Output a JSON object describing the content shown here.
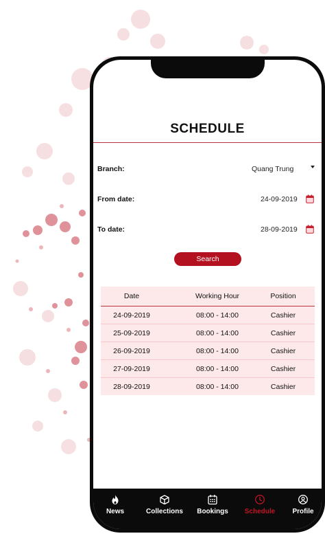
{
  "screen": {
    "title": "SCHEDULE"
  },
  "form": {
    "branch": {
      "label": "Branch:",
      "value": "Quang Trung",
      "icon": "chevron-down-icon"
    },
    "from_date": {
      "label": "From date:",
      "value": "24-09-2019",
      "icon": "calendar-icon"
    },
    "to_date": {
      "label": "To date:",
      "value": "28-09-2019",
      "icon": "calendar-icon"
    },
    "search_label": "Search"
  },
  "table": {
    "headers": [
      "Date",
      "Working Hour",
      "Position"
    ],
    "rows": [
      [
        "24-09-2019",
        "08:00 - 14:00",
        "Cashier"
      ],
      [
        "25-09-2019",
        "08:00 - 14:00",
        "Cashier"
      ],
      [
        "26-09-2019",
        "08:00 - 14:00",
        "Cashier"
      ],
      [
        "27-09-2019",
        "08:00 - 14:00",
        "Cashier"
      ],
      [
        "28-09-2019",
        "08:00 - 14:00",
        "Cashier"
      ]
    ]
  },
  "tabbar": {
    "items": [
      {
        "label": "News",
        "icon": "flame-icon",
        "active": false
      },
      {
        "label": "Collections",
        "icon": "box-icon",
        "active": false
      },
      {
        "label": "Bookings",
        "icon": "calendar-grid-icon",
        "active": false
      },
      {
        "label": "Schedule",
        "icon": "clock-icon",
        "active": true
      },
      {
        "label": "Profile",
        "icon": "user-icon",
        "active": false
      }
    ]
  },
  "colors": {
    "accent": "#b3111f",
    "table_bg": "#fde9ea",
    "tabbar_bg": "#0b0b0b",
    "active_tab": "#c01425"
  }
}
